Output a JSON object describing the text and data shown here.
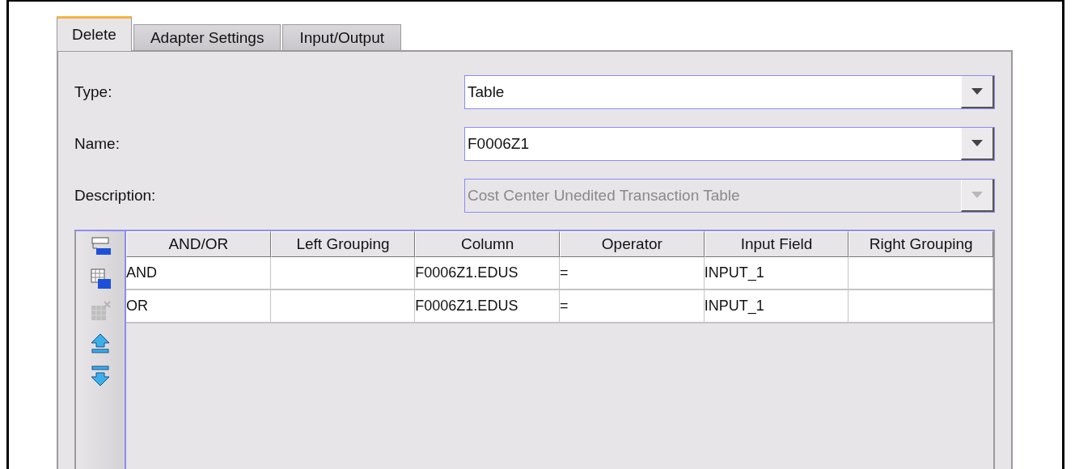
{
  "tabs": [
    {
      "label": "Delete",
      "selected": true
    },
    {
      "label": "Adapter Settings",
      "selected": false
    },
    {
      "label": "Input/Output",
      "selected": false
    }
  ],
  "fields": [
    {
      "label": "Type:",
      "value": "Table",
      "disabled": false
    },
    {
      "label": "Name:",
      "value": "F0006Z1",
      "disabled": false
    },
    {
      "label": "Description:",
      "value": "Cost Center Unedited Transaction Table",
      "disabled": true
    }
  ],
  "toolbar": [
    {
      "kind": "insert-row",
      "disabled": false
    },
    {
      "kind": "append-row",
      "disabled": false
    },
    {
      "kind": "delete-row",
      "disabled": true
    },
    {
      "kind": "move-up",
      "disabled": false
    },
    {
      "kind": "move-down",
      "disabled": false
    }
  ],
  "table": {
    "columns": [
      "AND/OR",
      "Left Grouping",
      "Column",
      "Operator",
      "Input Field",
      "Right Grouping"
    ],
    "rows": [
      [
        "AND",
        "",
        "F0006Z1.EDUS",
        "=",
        "INPUT_1",
        ""
      ],
      [
        "OR",
        "",
        "F0006Z1.EDUS",
        "=",
        "INPUT_1",
        ""
      ]
    ]
  }
}
